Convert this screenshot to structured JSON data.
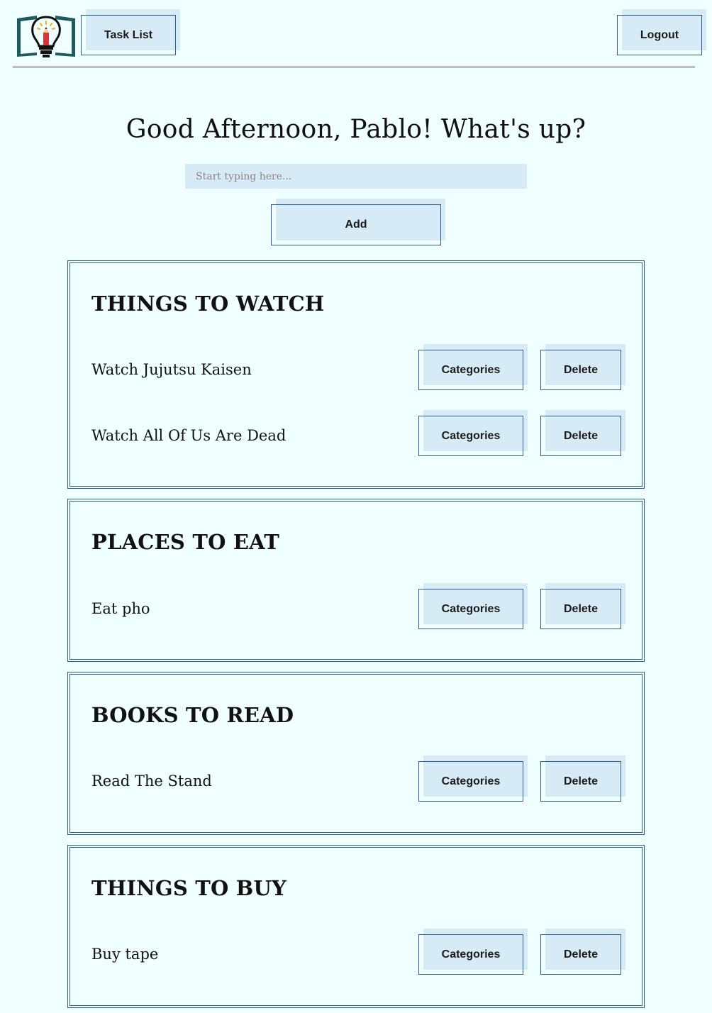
{
  "header": {
    "logo_icon": "lightbulb-book-icon",
    "nav": {
      "task_list_label": "Task List",
      "logout_label": "Logout"
    }
  },
  "main": {
    "greeting": "Good Afternoon, Pablo! What's up?",
    "new_task": {
      "placeholder": "Start typing here...",
      "value": ""
    },
    "add_label": "Add"
  },
  "categories": [
    {
      "title": "THINGS TO WATCH",
      "tasks": [
        {
          "text": "Watch Jujutsu Kaisen",
          "categories_label": "Categories",
          "delete_label": "Delete"
        },
        {
          "text": "Watch All Of Us Are Dead",
          "categories_label": "Categories",
          "delete_label": "Delete"
        }
      ]
    },
    {
      "title": "PLACES TO EAT",
      "tasks": [
        {
          "text": "Eat pho",
          "categories_label": "Categories",
          "delete_label": "Delete"
        }
      ]
    },
    {
      "title": "BOOKS TO READ",
      "tasks": [
        {
          "text": "Read The Stand",
          "categories_label": "Categories",
          "delete_label": "Delete"
        }
      ]
    },
    {
      "title": "THINGS TO BUY",
      "tasks": [
        {
          "text": "Buy tape",
          "categories_label": "Categories",
          "delete_label": "Delete"
        }
      ]
    }
  ],
  "colors": {
    "background": "#f0ffff",
    "accent": "#2b5d8e",
    "button_fill": "#d6ebf5",
    "divider": "#bcbcbc"
  }
}
